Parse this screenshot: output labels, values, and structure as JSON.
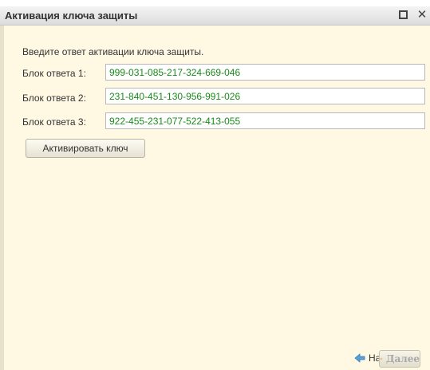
{
  "window": {
    "title": "Активация ключа защиты",
    "maximize_icon": "maximize-icon",
    "close_icon": "close-icon",
    "close_glyph": "✕"
  },
  "form": {
    "prompt": "Введите ответ активации ключа защиты.",
    "rows": [
      {
        "label": "Блок ответа 1:",
        "value": "999-031-085-217-324-669-046"
      },
      {
        "label": "Блок ответа 2:",
        "value": "231-840-451-130-956-991-026"
      },
      {
        "label": "Блок ответа 3:",
        "value": "922-455-231-077-522-413-055"
      }
    ],
    "activate_label": "Активировать ключ"
  },
  "footer": {
    "back_label": "Назад",
    "next_label": "Далее"
  },
  "colors": {
    "value_text": "#1a8a1a",
    "background": "#fff9e4",
    "arrow": "#5a9fd6"
  }
}
